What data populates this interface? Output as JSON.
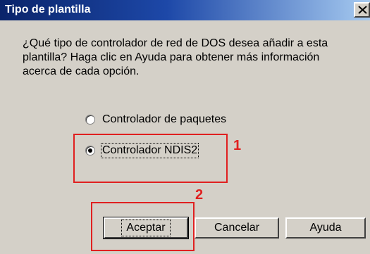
{
  "window": {
    "title": "Tipo de plantilla",
    "close_label": "close"
  },
  "prompt": {
    "text": "¿Qué tipo de controlador de red de DOS desea añadir a esta plantilla? Haga clic en Ayuda para obtener más información acerca de cada opción."
  },
  "options": [
    {
      "label": "Controlador de paquetes",
      "selected": false
    },
    {
      "label": "Controlador NDIS2",
      "selected": true
    }
  ],
  "buttons": {
    "ok": "Aceptar",
    "cancel": "Cancelar",
    "help": "Ayuda"
  },
  "annotations": {
    "marker_1": "1",
    "marker_2": "2",
    "color": "#e02020"
  },
  "colors": {
    "titlebar_start": "#0a246a",
    "titlebar_end": "#a6caf0",
    "dialog_bg": "#d4d0c8"
  }
}
